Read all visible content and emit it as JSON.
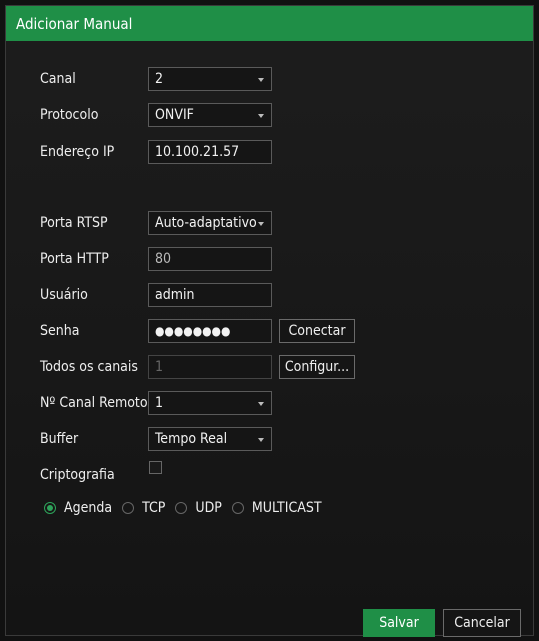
{
  "dialog": {
    "title": "Adicionar Manual"
  },
  "fields": {
    "canal": {
      "label": "Canal",
      "value": "2"
    },
    "protocolo": {
      "label": "Protocolo",
      "value": "ONVIF"
    },
    "endereco_ip": {
      "label": "Endereço IP",
      "value": "10.100.21.57"
    },
    "porta_rtsp": {
      "label": "Porta RTSP",
      "value": "Auto-adaptativo"
    },
    "porta_http": {
      "label": "Porta HTTP",
      "value": "80"
    },
    "usuario": {
      "label": "Usuário",
      "value": "admin"
    },
    "senha": {
      "label": "Senha",
      "value": "●●●●●●●●"
    },
    "todos_canais": {
      "label": "Todos os canais",
      "value": "1"
    },
    "canal_remoto": {
      "label": "Nº Canal Remoto",
      "value": "1"
    },
    "buffer": {
      "label": "Buffer",
      "value": "Tempo Real"
    },
    "criptografia": {
      "label": "Criptografia",
      "checked": false
    }
  },
  "buttons": {
    "conectar": "Conectar",
    "configurar": "Configur...",
    "salvar": "Salvar",
    "cancelar": "Cancelar"
  },
  "radios": {
    "agenda": {
      "label": "Agenda",
      "checked": true
    },
    "tcp": {
      "label": "TCP",
      "checked": false
    },
    "udp": {
      "label": "UDP",
      "checked": false
    },
    "multicast": {
      "label": "MULTICAST",
      "checked": false
    }
  },
  "colors": {
    "accent": "#1f8f47",
    "radio_selected": "#2ea35a"
  }
}
